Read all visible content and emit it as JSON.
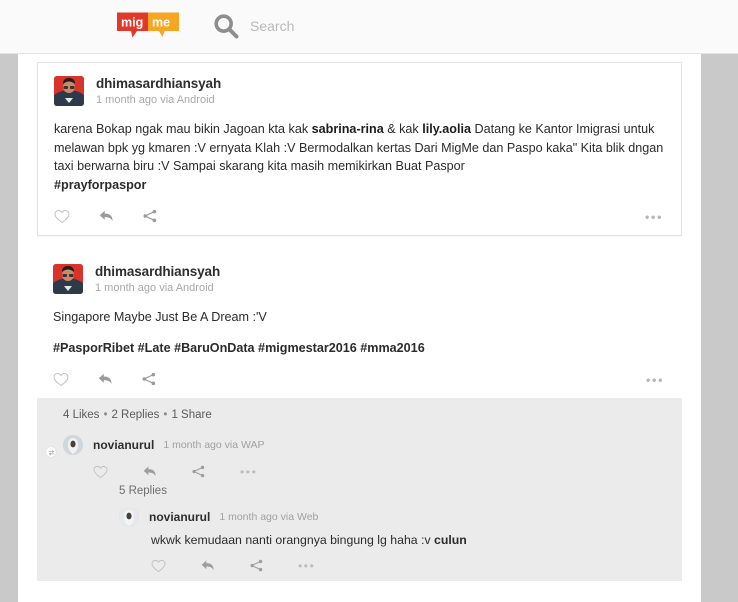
{
  "header": {
    "logo_text_left": "mig",
    "logo_text_right": "me",
    "logo_color_left": "#e0392b",
    "logo_color_right": "#f5a623",
    "search_icon": "search-icon",
    "search_placeholder": "Search",
    "search_value": ""
  },
  "posts": [
    {
      "author": "dhimasardhiansyah",
      "meta": "1 month ago via Android",
      "body_line1_pre": "karena Bokap ngak mau bikin Jagoan kta kak ",
      "body_mention1": "sabrina-rina",
      "body_mid": " & kak ",
      "body_mention2": "lily.aolia",
      "body_rest": " Datang ke Kantor Imigrasi untuk melawan bpk yg kmaren :V ernyata Klah :V Bermodalkan kertas Dari MigMe dan Paspo kaka\" Kita blik dngan taxi berwarna biru :V Sampai skarang kita masih memikirkan Buat Paspor",
      "hashtag_line": "#prayforpaspor",
      "actions": {
        "like": "heart-icon",
        "reply": "reply-icon",
        "share": "share-icon",
        "more": "•••"
      }
    },
    {
      "author": "dhimasardhiansyah",
      "meta": "1 month ago via Android",
      "body_line1": "Singapore Maybe Just Be A Dream :'V",
      "hashtag_line": "#PasporRibet #Late #BaruOnData #migmestar2016 #mma2016",
      "actions": {
        "like": "heart-icon",
        "reply": "reply-icon",
        "share": "share-icon",
        "more": "•••"
      },
      "stats": {
        "likes": "4 Likes",
        "replies": "2 Replies",
        "shares": "1 Share",
        "separator": "•"
      },
      "comments": [
        {
          "author": "novianurul",
          "meta": "1 month ago via WAP",
          "text": "",
          "replies_label": "5 Replies",
          "actions": {
            "like": "heart-icon",
            "reply": "reply-icon",
            "share": "share-icon",
            "more": "•••"
          },
          "nested": [
            {
              "author": "novianurul",
              "meta": "1 month ago via Web",
              "text_pre": "wkwk kemudaan nanti orangnya bingung lg haha :v ",
              "text_bold": "culun",
              "actions": {
                "like": "heart-icon",
                "reply": "reply-icon",
                "share": "share-icon",
                "more": "•••"
              }
            }
          ]
        }
      ]
    }
  ]
}
